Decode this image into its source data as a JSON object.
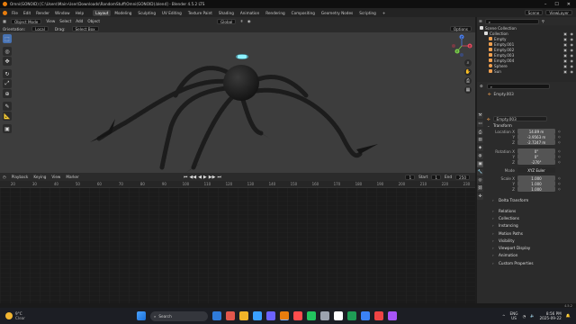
{
  "window": {
    "title": "Omni(GONOID) [C:\\Users\\Main-User\\Downloads\\RandomStuff\\Omni(GONOID).blend] - Blender 4.5.2 LTS",
    "controls": [
      "–",
      "☐",
      "✕"
    ]
  },
  "menubar": {
    "items": [
      "File",
      "Edit",
      "Render",
      "Window",
      "Help"
    ],
    "workspaces": [
      "Layout",
      "Modeling",
      "Sculpting",
      "UV Editing",
      "Texture Paint",
      "Shading",
      "Animation",
      "Rendering",
      "Compositing",
      "Geometry Nodes",
      "Scripting",
      "+"
    ],
    "active_workspace": "Layout",
    "scene_label": "Scene",
    "viewlayer_label": "ViewLayer"
  },
  "viewport": {
    "header_items": [
      "Object Mode",
      "View",
      "Select",
      "Add",
      "Object"
    ],
    "transform_global": "Global",
    "orientation_label": "Orientation:",
    "orientation_value": "Local",
    "drag_label": "Drag:",
    "drag_value": "Select Box",
    "options_label": "Options",
    "gizmo_axes": {
      "x": "X",
      "y": "Y",
      "z": "Z"
    },
    "colors": {
      "bg": "#3d3d3d",
      "glow": "#5fe8ff",
      "body": "#1a1a1a"
    }
  },
  "toolbar": {
    "tools": [
      "select-box",
      "cursor",
      "move",
      "rotate",
      "scale",
      "transform",
      "annotate",
      "measure",
      "add-cube"
    ],
    "glyphs": [
      "⬚",
      "◎",
      "✥",
      "↻",
      "⤢",
      "⊕",
      "✎",
      "📐",
      "▣"
    ]
  },
  "timeline": {
    "menu": [
      "Playback",
      "Keying",
      "View",
      "Marker"
    ],
    "current_frame": "1",
    "start_label": "Start",
    "start_value": "1",
    "end_label": "End",
    "end_value": "250",
    "ruler": [
      "20",
      "30",
      "40",
      "50",
      "60",
      "70",
      "80",
      "90",
      "100",
      "110",
      "120",
      "130",
      "140",
      "150",
      "160",
      "170",
      "180",
      "190",
      "200",
      "210",
      "220",
      "230"
    ],
    "playback_icons": [
      "⏮",
      "◀◀",
      "◀",
      "▶",
      "▶▶",
      "⏭"
    ]
  },
  "statusbar": {
    "version": "4.5.2"
  },
  "outliner": {
    "search_placeholder": "",
    "rows": [
      {
        "label": "Scene Collection",
        "depth": 0,
        "icon": "scene-collection"
      },
      {
        "label": "Collection",
        "depth": 1,
        "icon": "collection"
      },
      {
        "label": "Empty",
        "depth": 2,
        "icon": "empty"
      },
      {
        "label": "Empty.001",
        "depth": 2,
        "icon": "empty"
      },
      {
        "label": "Empty.002",
        "depth": 2,
        "icon": "empty"
      },
      {
        "label": "Empty.003",
        "depth": 2,
        "icon": "empty"
      },
      {
        "label": "Empty.004",
        "depth": 2,
        "icon": "empty"
      },
      {
        "label": "Sphere",
        "depth": 2,
        "icon": "mesh"
      },
      {
        "label": "Sun",
        "depth": 2,
        "icon": "light"
      }
    ]
  },
  "properties": {
    "object_name": "Empty.003",
    "object_name_field": "Empty.003",
    "transform_header": "Transform",
    "location_label": "Location X",
    "location": [
      "14.89 m",
      "-3.9563 m",
      "-2.7247 m"
    ],
    "rotation_label": "Rotation X",
    "rotation": [
      "0°",
      "0°",
      "-270°"
    ],
    "mode_label": "Mode",
    "mode_value": "XYZ Euler",
    "scale_label": "Scale X",
    "scale": [
      "1.000",
      "1.000",
      "1.000"
    ],
    "y_label": "Y",
    "z_label": "Z",
    "delta_header": "Delta Transform",
    "panels": [
      "Relations",
      "Collections",
      "Instancing",
      "Motion Paths",
      "Visibility",
      "Viewport Display",
      "Animation",
      "Custom Properties"
    ]
  },
  "taskbar": {
    "weather_temp": "9°C",
    "weather_desc": "Clear",
    "search_placeholder": "Search",
    "app_colors": [
      "#2f7bd8",
      "#e2574c",
      "#f0b429",
      "#3aa0ff",
      "#6c63ff",
      "#e87d0d",
      "#ff4d4d",
      "#22c55e",
      "#9ca3af",
      "#ffffff",
      "#1f9d55",
      "#3b82f6",
      "#ef4444",
      "#a855f7"
    ],
    "lang": "ENG",
    "region": "US",
    "time": "8:56 PM",
    "date": "2025-09-22"
  }
}
